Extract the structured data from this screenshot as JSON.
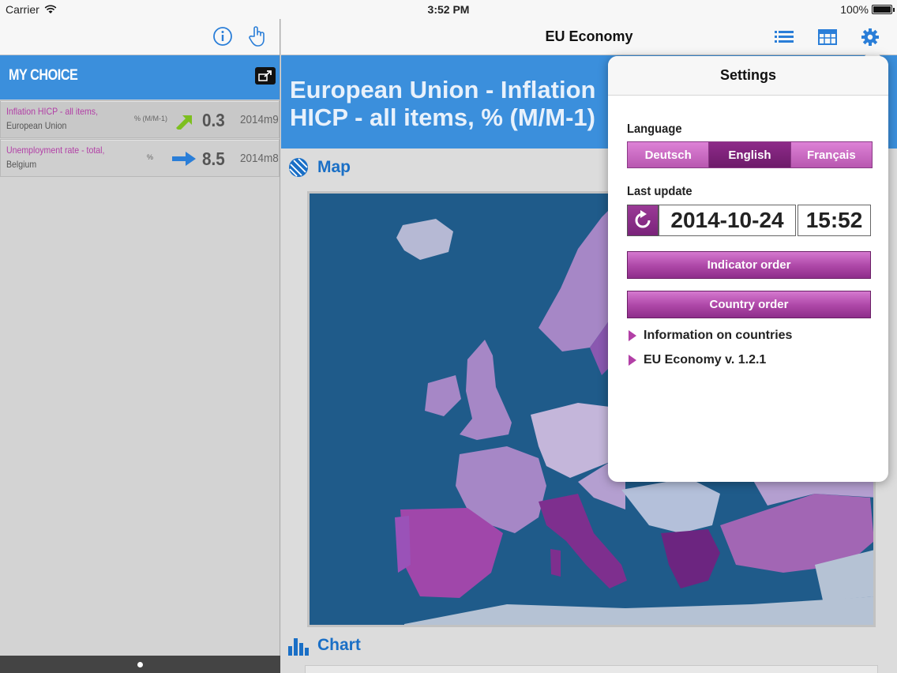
{
  "status_bar": {
    "carrier": "Carrier",
    "time": "3:52 PM",
    "battery": "100%"
  },
  "left_nav": {
    "info_icon": "info-icon",
    "touch_icon": "hand-pointer-icon"
  },
  "my_choice": {
    "title": "MY CHOICE",
    "rows": [
      {
        "indicator": "Inflation HICP - all items,",
        "country": "European Union",
        "unit": "% (M/M-1)",
        "trend": "up",
        "trend_color": "#7dbf1f",
        "value": "0.3",
        "period": "2014m9"
      },
      {
        "indicator": "Unemployment rate - total,",
        "country": "Belgium",
        "unit": "%",
        "trend": "flat",
        "trend_color": "#2a7ed8",
        "value": "8.5",
        "period": "2014m8"
      }
    ]
  },
  "main_nav": {
    "title": "EU Economy",
    "icons": [
      "list-icon",
      "table-icon",
      "gear-icon"
    ]
  },
  "banner": {
    "title": "European Union - Inflation HICP - all items, % (M/M-1)"
  },
  "sections": {
    "map_label": "Map",
    "chart_label": "Chart"
  },
  "settings": {
    "title": "Settings",
    "language_label": "Language",
    "languages": [
      "Deutsch",
      "English",
      "Français"
    ],
    "selected_language": "English",
    "last_update_label": "Last update",
    "last_update_date": "2014-10-24",
    "last_update_time": "15:52",
    "indicator_order": "Indicator order",
    "country_order": "Country order",
    "info_countries": "Information on countries",
    "version": "EU Economy v. 1.2.1"
  },
  "colors": {
    "accent_blue": "#3b8fdc",
    "accent_purple": "#b23fa6",
    "sea": "#1f5b8a"
  }
}
